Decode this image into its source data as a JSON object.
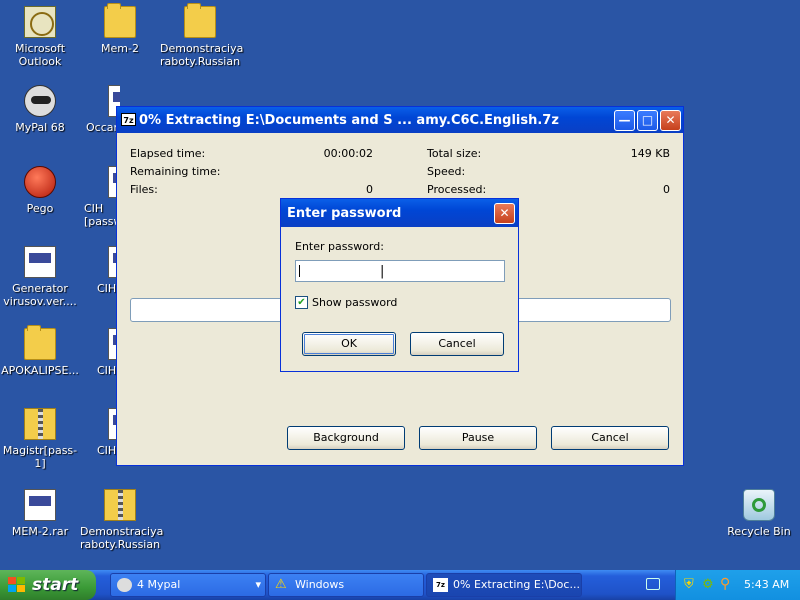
{
  "desktop": {
    "icons": [
      {
        "label": "Microsoft Outlook",
        "icon": "outlook-icon"
      },
      {
        "label": "Mem-2",
        "icon": "folder-icon"
      },
      {
        "label": "Demonstraciya raboty.Russian",
        "icon": "folder-icon"
      },
      {
        "label": "MyPal 68",
        "icon": "mypal-raccoon-icon"
      },
      {
        "label": "Occan",
        "icon": "document-icon"
      },
      {
        "label": "Pego",
        "icon": "pego-icon"
      },
      {
        "label": "CIH [passw",
        "icon": "document-icon"
      },
      {
        "label": "Generator virusov.ver....",
        "icon": "document-icon"
      },
      {
        "label": "CIH",
        "icon": "document-icon"
      },
      {
        "label": "APOKALIPSE...",
        "icon": "folder-icon"
      },
      {
        "label": "CIH",
        "icon": "document-icon"
      },
      {
        "label": "Magistr[pass-1]",
        "icon": "zip-folder-icon"
      },
      {
        "label": "CIH",
        "icon": "document-icon"
      },
      {
        "label": "MEM-2.rar",
        "icon": "rar-document-icon"
      },
      {
        "label": "Demonstraciya raboty.Russian",
        "icon": "zip-folder-icon"
      },
      {
        "label": "Recycle Bin",
        "icon": "recycle-bin-icon"
      }
    ]
  },
  "extract_window": {
    "app_icon": "7z",
    "title": "0% Extracting E:\\Documents and S ... amy.C6C.English.7z",
    "elapsed_label": "Elapsed time:",
    "elapsed_value": "00:00:02",
    "remaining_label": "Remaining time:",
    "files_label": "Files:",
    "files_value": "0",
    "total_size_label": "Total size:",
    "total_size_value": "149 KB",
    "speed_label": "Speed:",
    "processed_label": "Processed:",
    "processed_value": "0",
    "progress_fraction": 0,
    "background_label": "Background",
    "pause_label": "Pause",
    "cancel_label": "Cancel"
  },
  "password_dialog": {
    "title": "Enter password",
    "prompt": "Enter password:",
    "input_value": "",
    "show_password_label": "Show password",
    "show_password_checked": true,
    "ok_label": "OK",
    "cancel_label": "Cancel"
  },
  "taskbar": {
    "start_label": "start",
    "tasks": [
      {
        "label": "4 Mypal",
        "icon": "mypal-raccoon-icon"
      },
      {
        "label": "Windows",
        "icon": "warning-icon"
      },
      {
        "label": "0% Extracting E:\\Doc...",
        "icon": "7zip-icon"
      }
    ],
    "clock": "5:43 AM"
  },
  "colors": {
    "desktop": "#2a55a5",
    "titlebar": "#0046d5",
    "taskbar": "#245edb",
    "start": "#3a9a36"
  }
}
